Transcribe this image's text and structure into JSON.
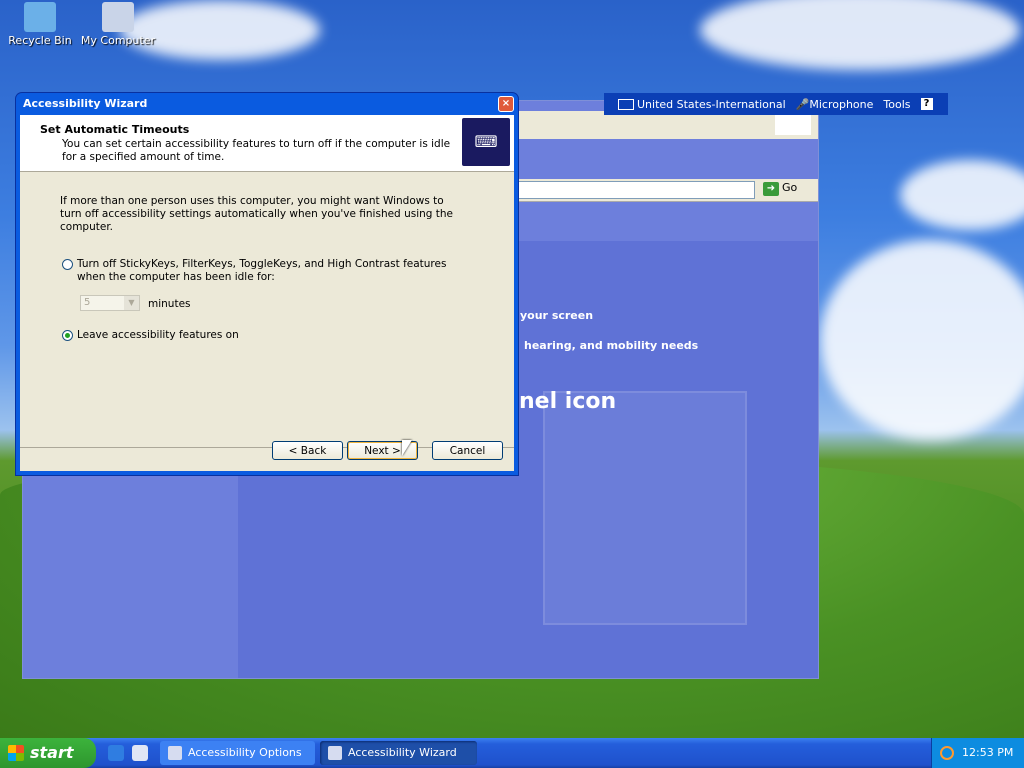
{
  "desktop": {
    "icons": [
      {
        "label": "Recycle Bin",
        "icon": "recycle-bin-icon"
      },
      {
        "label": "My Computer",
        "icon": "my-computer-icon"
      }
    ]
  },
  "background_window": {
    "go_label": "Go",
    "fragments": [
      "your screen",
      "hearing, and mobility needs",
      "nel icon"
    ]
  },
  "language_bar": {
    "language": "United States-International",
    "microphone": "Microphone",
    "tools": "Tools",
    "help": "?"
  },
  "wizard": {
    "title": "Accessibility Wizard",
    "close": "×",
    "header_title": "Set Automatic Timeouts",
    "header_desc": "You can set certain accessibility features to turn off if the computer is idle for a specified amount of time.",
    "intro": "If more than one person uses this computer, you might want Windows to turn off accessibility settings automatically when you've finished using the computer.",
    "option_off": "Turn off StickyKeys, FilterKeys, ToggleKeys, and High Contrast features when the computer has been idle for:",
    "minutes_value": "5",
    "minutes_label": "minutes",
    "option_on": "Leave accessibility features on",
    "selected_option": "option_on",
    "back": "< Back",
    "next": "Next >",
    "cancel": "Cancel"
  },
  "taskbar": {
    "start": "start",
    "tasks": [
      "Accessibility Options",
      "Accessibility Wizard"
    ],
    "active_task": "Accessibility Wizard",
    "clock": "12:53 PM"
  },
  "colors": {
    "xp_blue": "#0a5be0",
    "start_green": "#2e962e",
    "dialog_face": "#ece9d8"
  }
}
